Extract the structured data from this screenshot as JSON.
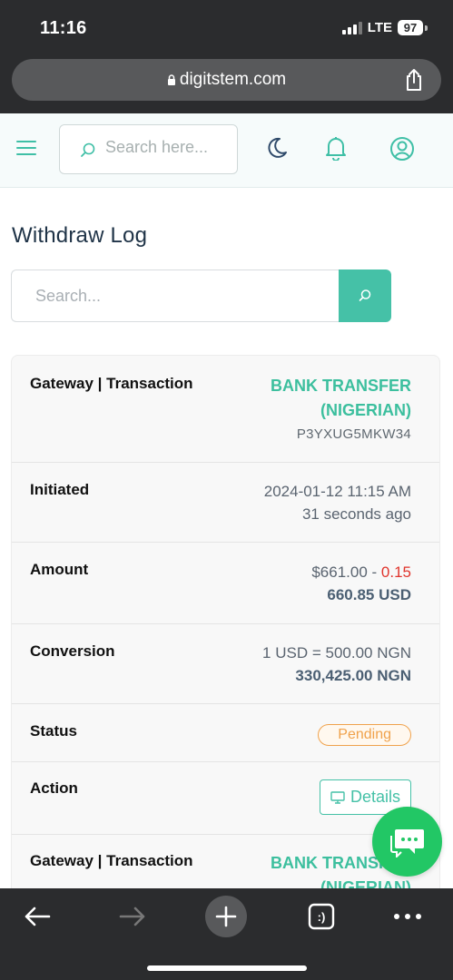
{
  "status_bar": {
    "time": "11:16",
    "network": "LTE",
    "battery": "97"
  },
  "browser": {
    "url": "digitstem.com"
  },
  "header": {
    "search_placeholder": "Search here..."
  },
  "page": {
    "title": "Withdraw Log",
    "search_placeholder": "Search..."
  },
  "record": {
    "gateway_label": "Gateway | Transaction",
    "gateway_line1": "BANK TRANSFER",
    "gateway_line2": "(NIGERIAN)",
    "transaction_id": "P3YXUG5MKW34",
    "initiated_label": "Initiated",
    "initiated_date": "2024-01-12 11:15 AM",
    "initiated_ago": "31 seconds ago",
    "amount_label": "Amount",
    "amount_gross": "$661.00",
    "amount_sep": " - ",
    "amount_fee": "0.15",
    "amount_net": "660.85 USD",
    "conversion_label": "Conversion",
    "conversion_rate": "1 USD = 500.00 NGN",
    "conversion_total": "330,425.00 NGN",
    "status_label": "Status",
    "status_value": "Pending",
    "action_label": "Action",
    "action_button": "Details"
  },
  "next_record": {
    "gateway_label": "Gateway | Transaction",
    "gateway_line1": "BANK TRANSFER",
    "gateway_line2": "(NIGERIAN)"
  },
  "colors": {
    "accent": "#45c1a7",
    "gateway_text": "#3cbf9e",
    "fee": "#e0342c",
    "pending": "#f0a24c",
    "chat": "#22c765"
  }
}
